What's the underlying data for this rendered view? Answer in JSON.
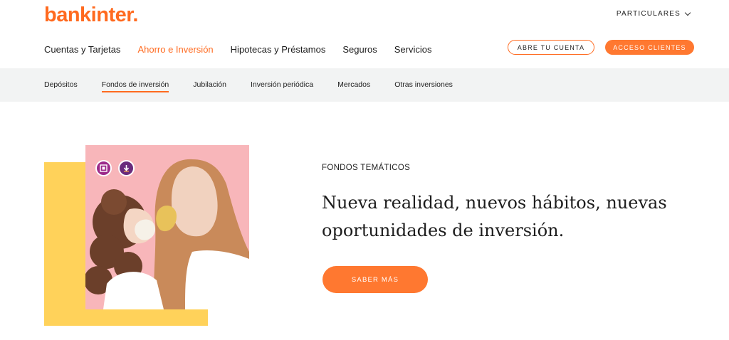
{
  "brand": {
    "logo_text": "bankinter.",
    "accent_color": "#ff6a1f"
  },
  "header": {
    "segment_selector": {
      "label": "PARTICULARES",
      "icon": "chevron-down-icon"
    },
    "main_nav": [
      {
        "label": "Cuentas y Tarjetas",
        "active": false
      },
      {
        "label": "Ahorro e Inversión",
        "active": true
      },
      {
        "label": "Hipotecas y Préstamos",
        "active": false
      },
      {
        "label": "Seguros",
        "active": false
      },
      {
        "label": "Servicios",
        "active": false
      }
    ],
    "open_account_label": "ABRE TU CUENTA",
    "client_access_label": "ACCESO CLIENTES"
  },
  "sub_nav": [
    {
      "label": "Depósitos",
      "active": false
    },
    {
      "label": "Fondos de inversión",
      "active": true
    },
    {
      "label": "Jubilación",
      "active": false
    },
    {
      "label": "Inversión periódica",
      "active": false
    },
    {
      "label": "Mercados",
      "active": false
    },
    {
      "label": "Otras inversiones",
      "active": false
    }
  ],
  "hero": {
    "eyebrow": "FONDOS TEMÁTICOS",
    "headline": "Nueva realidad, nuevos hábitos, nuevas oportunidades de inversión.",
    "cta_label": "SABER MÁS",
    "image_icons": [
      "image-frame-icon",
      "download-arrow-icon"
    ]
  }
}
